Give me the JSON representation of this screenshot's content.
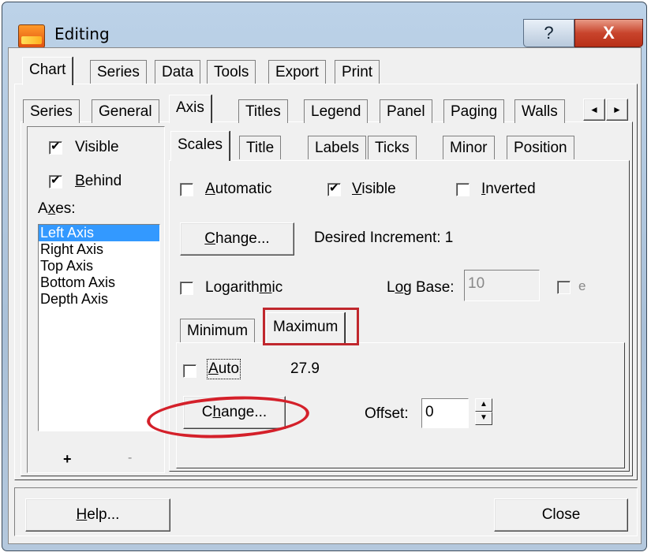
{
  "window": {
    "title": "Editing",
    "help_glyph": "?",
    "close_glyph": "X"
  },
  "top_tabs": [
    "Chart",
    "Series",
    "Data",
    "Tools",
    "Export",
    "Print"
  ],
  "second_tabs": [
    "Series",
    "General",
    "Axis",
    "Titles",
    "Legend",
    "Panel",
    "Paging",
    "Walls"
  ],
  "scroll_arrows": {
    "left": "◄",
    "right": "►"
  },
  "left_panel": {
    "visible_label": "Visible",
    "visible_checked": true,
    "behind_label": "Behind",
    "behind_checked": true,
    "axes_label": "Axes:",
    "axes": [
      "Left Axis",
      "Right Axis",
      "Top Axis",
      "Bottom Axis",
      "Depth Axis"
    ],
    "selected_axis": "Left Axis",
    "add_label": "+",
    "remove_label": "-"
  },
  "axis_tabs": [
    "Scales",
    "Title",
    "Labels",
    "Ticks",
    "Minor",
    "Position"
  ],
  "scales": {
    "automatic_label": "Automatic",
    "automatic_checked": false,
    "visible_label": "Visible",
    "visible_checked": true,
    "inverted_label": "Inverted",
    "inverted_checked": false,
    "change_label": "Change...",
    "desired_increment": "Desired Increment: 1",
    "logarithmic_label": "Logarithmic",
    "logarithmic_checked": false,
    "log_base_label": "Log Base:",
    "log_base_value": "10",
    "e_label": "e"
  },
  "minmax_tabs": [
    "Minimum",
    "Maximum"
  ],
  "maximum": {
    "auto_label": "Auto",
    "auto_checked": false,
    "value": "27.9",
    "change_label": "Change...",
    "offset_label": "Offset:",
    "offset_value": "0"
  },
  "footer": {
    "help_label": "Help...",
    "close_label": "Close"
  },
  "annotation_color": "#c0272d"
}
